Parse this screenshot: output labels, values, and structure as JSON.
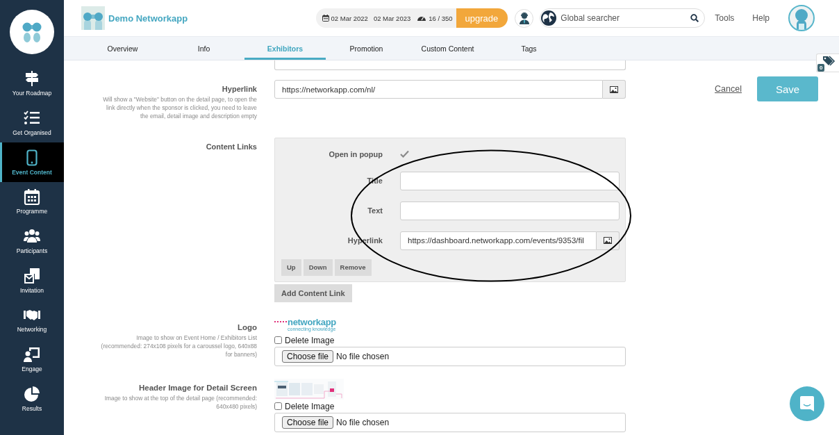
{
  "sidebar": {
    "items": [
      {
        "kind": "roadmap",
        "label": "Your Roadmap",
        "selected": false
      },
      {
        "kind": "checklist",
        "label": "Get Organised",
        "selected": false
      },
      {
        "kind": "phone",
        "label": "Event Content",
        "selected": true
      },
      {
        "kind": "calendar",
        "label": "Programme",
        "selected": false
      },
      {
        "kind": "people",
        "label": "Participants",
        "selected": false
      },
      {
        "kind": "invitation",
        "label": "Invitation",
        "selected": false
      },
      {
        "kind": "handshake",
        "label": "Networking",
        "selected": false
      },
      {
        "kind": "presentation",
        "label": "Engage",
        "selected": false
      },
      {
        "kind": "pie",
        "label": "Results",
        "selected": false
      }
    ]
  },
  "header": {
    "brand": "Demo Networkapp",
    "date_start": "02 Mar 2022",
    "date_end": "02 Mar 2023",
    "usage": "16 / 350",
    "upgrade": "upgrade",
    "search": {
      "placeholder": "Global searcher"
    },
    "links": [
      "Tools",
      "Help"
    ]
  },
  "tabs": [
    {
      "label": "Overview",
      "selected": false
    },
    {
      "label": "Info",
      "selected": false
    },
    {
      "label": "Exhibitors",
      "selected": true
    },
    {
      "label": "Promotion",
      "selected": false
    },
    {
      "label": "Custom Content",
      "selected": false
    },
    {
      "label": "Tags",
      "selected": false
    }
  ],
  "tag_counter": "0",
  "actions": {
    "cancel": "Cancel",
    "save": "Save"
  },
  "form": {
    "hyperlink": {
      "label": "Hyperlink",
      "help": "Will show a \"Website\" button on the detail page, to open the link directly when the sponsor is clicked, you need to leave the email, detail image and description empty",
      "value": "https://networkapp.com/nl/"
    },
    "content_links": {
      "label": "Content Links",
      "open_in_popup": {
        "label": "Open in popup",
        "checked": true
      },
      "fields": [
        {
          "kind": "text",
          "label": "Title"
        },
        {
          "kind": "text",
          "label": "Text"
        },
        {
          "kind": "url",
          "label": "Hyperlink",
          "value": "https://dashboard.networkapp.com/events/9353/fil"
        }
      ],
      "buttons": [
        "Up",
        "Down",
        "Remove"
      ],
      "add_button": "Add Content Link"
    },
    "logo": {
      "label": "Logo",
      "help": "Image to show on Event Home / Exhibitors List (recommended: 274x108 pixels for a caroussel logo, 640x88 for banners)",
      "preview": {
        "wordmark": "networkapp",
        "tagline": "connecting knowledge"
      },
      "delete": {
        "label": "Delete Image",
        "checked": false
      },
      "file": {
        "button": "Choose file",
        "status": "No file chosen"
      }
    },
    "header_image": {
      "label": "Header Image for Detail Screen",
      "help": "Image to show at the top of the detail page (recommended: 640x480 pixels)",
      "delete": {
        "label": "Delete Image",
        "checked": false
      },
      "file": {
        "button": "Choose file",
        "status": "No file chosen"
      }
    }
  }
}
